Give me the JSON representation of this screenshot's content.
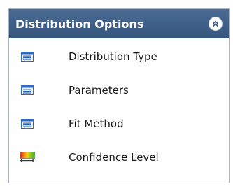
{
  "panel": {
    "title": "Distribution Options",
    "collapse_icon": "double-chevron-up-icon",
    "header_color": "#3e5f88"
  },
  "items": [
    {
      "label": "Distribution Type",
      "icon": "form-icon"
    },
    {
      "label": "Parameters",
      "icon": "form-icon"
    },
    {
      "label": "Fit Method",
      "icon": "form-icon"
    },
    {
      "label": "Confidence Level",
      "icon": "color-gradient-scale-icon"
    }
  ]
}
